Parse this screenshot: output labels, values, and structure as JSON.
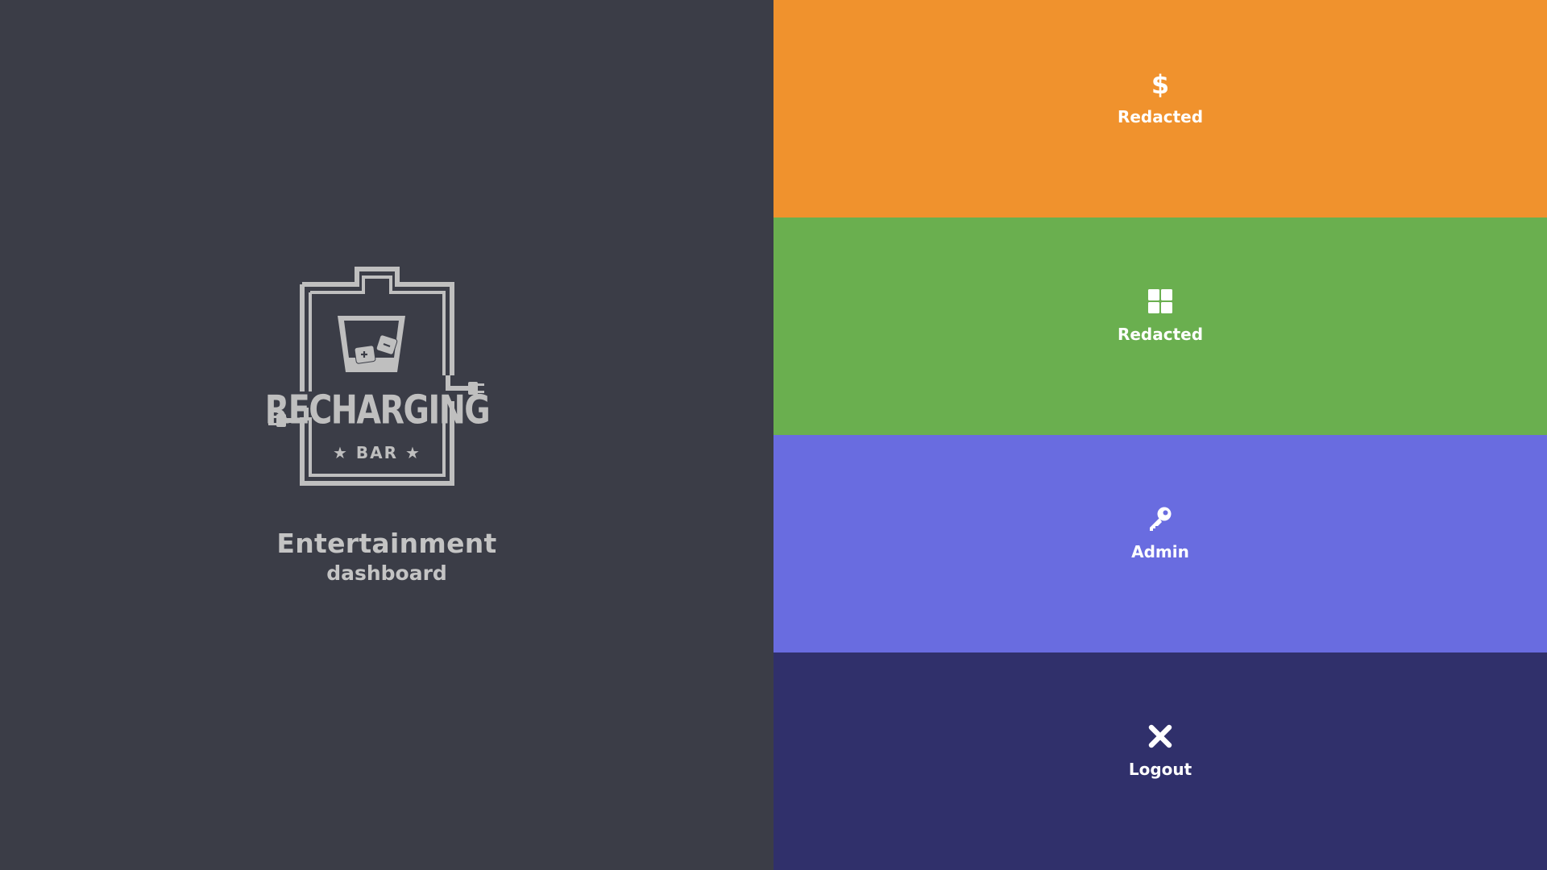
{
  "colors": {
    "left_background": "#3b3d47",
    "logo_gray": "#bfbfbf",
    "text_gray": "#c4c4c4",
    "tile_label": "#ffffff"
  },
  "branding": {
    "logo_text_main": "RECHARGING",
    "logo_text_sub": "★ BAR ★",
    "title": "Entertainment",
    "subtitle": "dashboard"
  },
  "menu": {
    "tiles": [
      {
        "label": "Redacted",
        "icon": "dollar-icon",
        "color": "#f0922d"
      },
      {
        "label": "Redacted",
        "icon": "grid-icon",
        "color": "#6aaf4f"
      },
      {
        "label": "Admin",
        "icon": "key-icon",
        "color": "#696ce0"
      },
      {
        "label": "Logout",
        "icon": "close-icon",
        "color": "#30306b"
      }
    ]
  }
}
